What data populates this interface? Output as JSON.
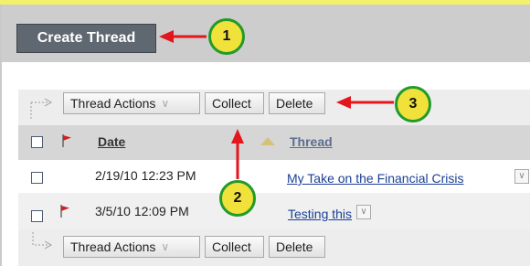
{
  "header": {
    "create_label": "Create Thread"
  },
  "toolbar_top": {
    "thread_actions": "Thread Actions",
    "collect": "Collect",
    "delete": "Delete"
  },
  "toolbar_bottom": {
    "thread_actions": "Thread Actions",
    "collect": "Collect",
    "delete": "Delete"
  },
  "table": {
    "columns": {
      "date": "Date",
      "thread": "Thread"
    },
    "rows": [
      {
        "date": "2/19/10 12:23 PM",
        "thread": "My Take on the Financial Crisis",
        "flagged": false
      },
      {
        "date": "3/5/10 12:09 PM",
        "thread": "Testing this",
        "flagged": true
      }
    ]
  },
  "callouts": [
    "1",
    "2",
    "3"
  ],
  "colors": {
    "accent_arrow": "#e3161d",
    "callout_fill": "#f0e23a",
    "callout_ring": "#229a2b",
    "top_strip": "#f3f06a"
  },
  "icons": {
    "flag": "red-flag-icon",
    "sort": "sort-ascending-icon",
    "menu": "chevron-down-icon",
    "indent": "indent-corner-icon"
  }
}
